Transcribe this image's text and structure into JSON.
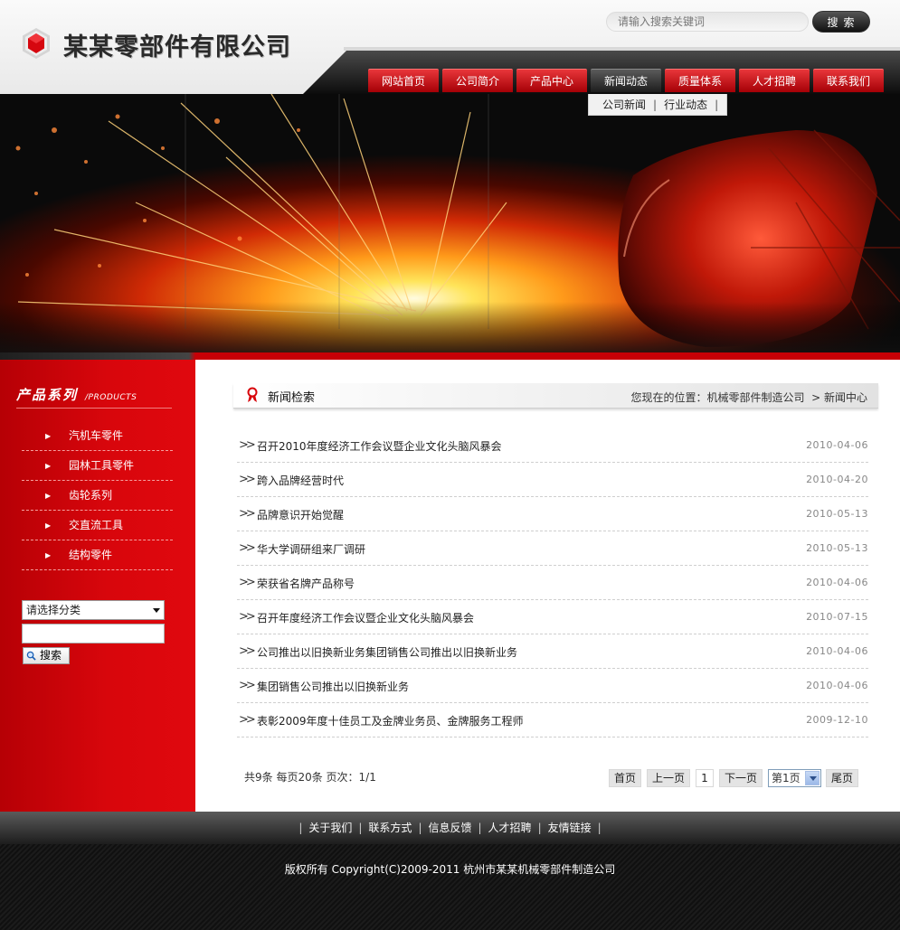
{
  "company": {
    "name": "某某零部件有限公司"
  },
  "search": {
    "placeholder": "请输入搜索关键词",
    "button": "搜索"
  },
  "nav": {
    "items": [
      "网站首页",
      "公司简介",
      "产品中心",
      "新闻动态",
      "质量体系",
      "人才招聘",
      "联系我们"
    ],
    "active": "新闻动态",
    "sub": [
      "公司新闻",
      "行业动态"
    ]
  },
  "sidebar": {
    "title": "产品系列",
    "title_en": "/PRODUCTS",
    "items": [
      "汽机车零件",
      "园林工具零件",
      "齿轮系列",
      "交直流工具",
      "结构零件"
    ],
    "select_value": "请选择分类",
    "search_button": "搜索"
  },
  "main": {
    "title": "新闻检索",
    "breadcrumb_prefix": "您现在的位置：",
    "breadcrumb_site": "机械零部件制造公司",
    "breadcrumb_current": "新闻中心",
    "news": [
      {
        "title": "召开2010年度经济工作会议暨企业文化头脑风暴会",
        "date": "2010-04-06"
      },
      {
        "title": "跨入品牌经营时代",
        "date": "2010-04-20"
      },
      {
        "title": "品牌意识开始觉醒",
        "date": "2010-05-13"
      },
      {
        "title": "华大学调研组来厂调研",
        "date": "2010-05-13"
      },
      {
        "title": "荣获省名牌产品称号",
        "date": "2010-04-06"
      },
      {
        "title": "召开年度经济工作会议暨企业文化头脑风暴会",
        "date": "2010-07-15"
      },
      {
        "title": "公司推出以旧换新业务集团销售公司推出以旧换新业务",
        "date": "2010-04-06"
      },
      {
        "title": "集团销售公司推出以旧换新业务",
        "date": "2010-04-06"
      },
      {
        "title": "表彰2009年度十佳员工及金牌业务员、金牌服务工程师",
        "date": "2009-12-10"
      }
    ],
    "pager": {
      "info": "共9条  每页20条  页次：1/1",
      "first": "首页",
      "prev": "上一页",
      "page": "1",
      "next": "下一页",
      "select": "第1页",
      "last": "尾页"
    }
  },
  "footer": {
    "links": [
      "关于我们",
      "联系方式",
      "信息反馈",
      "人才招聘",
      "友情链接"
    ],
    "copyright": "版权所有  Copyright(C)2009-2011 杭州市某某机械零部件制造公司"
  },
  "colors": {
    "brand_red": "#d8060c",
    "dark": "#1d1d1d"
  }
}
